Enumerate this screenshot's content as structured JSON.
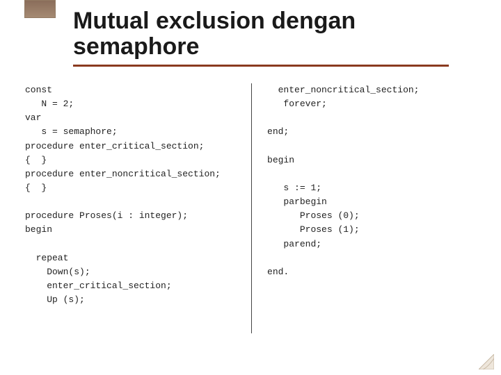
{
  "title": "Mutual exclusion dengan semaphore",
  "code": {
    "left": "const\n   N = 2;\nvar\n   s = semaphore;\nprocedure enter_critical_section;\n{  }\nprocedure enter_noncritical_section;\n{  }\n\nprocedure Proses(i : integer);\nbegin\n\n  repeat\n    Down(s);\n    enter_critical_section;\n    Up (s);",
    "right": "  enter_noncritical_section;\n   forever;\n\nend;\n\nbegin\n\n   s := 1;\n   parbegin\n      Proses (0);\n      Proses (1);\n   parend;\n\nend."
  }
}
